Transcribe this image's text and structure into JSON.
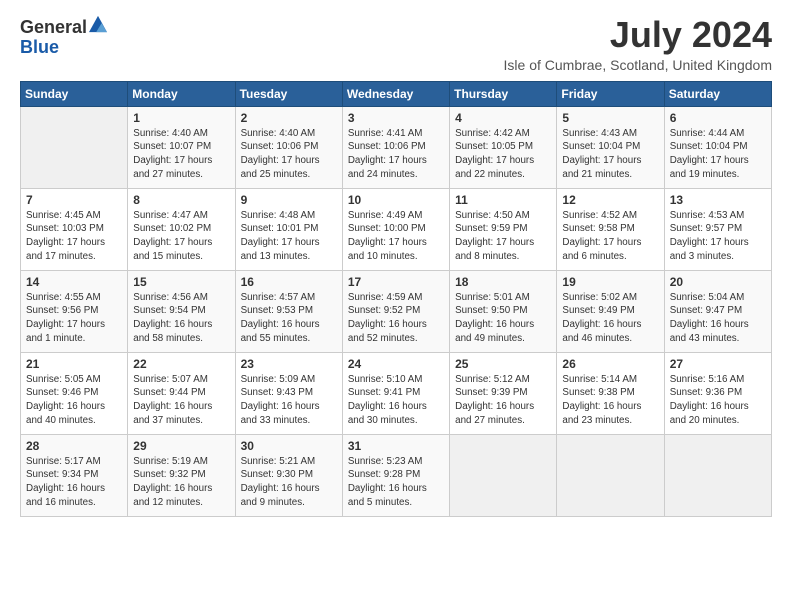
{
  "header": {
    "logo_general": "General",
    "logo_blue": "Blue",
    "month_title": "July 2024",
    "subtitle": "Isle of Cumbrae, Scotland, United Kingdom"
  },
  "weekdays": [
    "Sunday",
    "Monday",
    "Tuesday",
    "Wednesday",
    "Thursday",
    "Friday",
    "Saturday"
  ],
  "weeks": [
    [
      {
        "day": "",
        "info": ""
      },
      {
        "day": "1",
        "info": "Sunrise: 4:40 AM\nSunset: 10:07 PM\nDaylight: 17 hours\nand 27 minutes."
      },
      {
        "day": "2",
        "info": "Sunrise: 4:40 AM\nSunset: 10:06 PM\nDaylight: 17 hours\nand 25 minutes."
      },
      {
        "day": "3",
        "info": "Sunrise: 4:41 AM\nSunset: 10:06 PM\nDaylight: 17 hours\nand 24 minutes."
      },
      {
        "day": "4",
        "info": "Sunrise: 4:42 AM\nSunset: 10:05 PM\nDaylight: 17 hours\nand 22 minutes."
      },
      {
        "day": "5",
        "info": "Sunrise: 4:43 AM\nSunset: 10:04 PM\nDaylight: 17 hours\nand 21 minutes."
      },
      {
        "day": "6",
        "info": "Sunrise: 4:44 AM\nSunset: 10:04 PM\nDaylight: 17 hours\nand 19 minutes."
      }
    ],
    [
      {
        "day": "7",
        "info": "Sunrise: 4:45 AM\nSunset: 10:03 PM\nDaylight: 17 hours\nand 17 minutes."
      },
      {
        "day": "8",
        "info": "Sunrise: 4:47 AM\nSunset: 10:02 PM\nDaylight: 17 hours\nand 15 minutes."
      },
      {
        "day": "9",
        "info": "Sunrise: 4:48 AM\nSunset: 10:01 PM\nDaylight: 17 hours\nand 13 minutes."
      },
      {
        "day": "10",
        "info": "Sunrise: 4:49 AM\nSunset: 10:00 PM\nDaylight: 17 hours\nand 10 minutes."
      },
      {
        "day": "11",
        "info": "Sunrise: 4:50 AM\nSunset: 9:59 PM\nDaylight: 17 hours\nand 8 minutes."
      },
      {
        "day": "12",
        "info": "Sunrise: 4:52 AM\nSunset: 9:58 PM\nDaylight: 17 hours\nand 6 minutes."
      },
      {
        "day": "13",
        "info": "Sunrise: 4:53 AM\nSunset: 9:57 PM\nDaylight: 17 hours\nand 3 minutes."
      }
    ],
    [
      {
        "day": "14",
        "info": "Sunrise: 4:55 AM\nSunset: 9:56 PM\nDaylight: 17 hours\nand 1 minute."
      },
      {
        "day": "15",
        "info": "Sunrise: 4:56 AM\nSunset: 9:54 PM\nDaylight: 16 hours\nand 58 minutes."
      },
      {
        "day": "16",
        "info": "Sunrise: 4:57 AM\nSunset: 9:53 PM\nDaylight: 16 hours\nand 55 minutes."
      },
      {
        "day": "17",
        "info": "Sunrise: 4:59 AM\nSunset: 9:52 PM\nDaylight: 16 hours\nand 52 minutes."
      },
      {
        "day": "18",
        "info": "Sunrise: 5:01 AM\nSunset: 9:50 PM\nDaylight: 16 hours\nand 49 minutes."
      },
      {
        "day": "19",
        "info": "Sunrise: 5:02 AM\nSunset: 9:49 PM\nDaylight: 16 hours\nand 46 minutes."
      },
      {
        "day": "20",
        "info": "Sunrise: 5:04 AM\nSunset: 9:47 PM\nDaylight: 16 hours\nand 43 minutes."
      }
    ],
    [
      {
        "day": "21",
        "info": "Sunrise: 5:05 AM\nSunset: 9:46 PM\nDaylight: 16 hours\nand 40 minutes."
      },
      {
        "day": "22",
        "info": "Sunrise: 5:07 AM\nSunset: 9:44 PM\nDaylight: 16 hours\nand 37 minutes."
      },
      {
        "day": "23",
        "info": "Sunrise: 5:09 AM\nSunset: 9:43 PM\nDaylight: 16 hours\nand 33 minutes."
      },
      {
        "day": "24",
        "info": "Sunrise: 5:10 AM\nSunset: 9:41 PM\nDaylight: 16 hours\nand 30 minutes."
      },
      {
        "day": "25",
        "info": "Sunrise: 5:12 AM\nSunset: 9:39 PM\nDaylight: 16 hours\nand 27 minutes."
      },
      {
        "day": "26",
        "info": "Sunrise: 5:14 AM\nSunset: 9:38 PM\nDaylight: 16 hours\nand 23 minutes."
      },
      {
        "day": "27",
        "info": "Sunrise: 5:16 AM\nSunset: 9:36 PM\nDaylight: 16 hours\nand 20 minutes."
      }
    ],
    [
      {
        "day": "28",
        "info": "Sunrise: 5:17 AM\nSunset: 9:34 PM\nDaylight: 16 hours\nand 16 minutes."
      },
      {
        "day": "29",
        "info": "Sunrise: 5:19 AM\nSunset: 9:32 PM\nDaylight: 16 hours\nand 12 minutes."
      },
      {
        "day": "30",
        "info": "Sunrise: 5:21 AM\nSunset: 9:30 PM\nDaylight: 16 hours\nand 9 minutes."
      },
      {
        "day": "31",
        "info": "Sunrise: 5:23 AM\nSunset: 9:28 PM\nDaylight: 16 hours\nand 5 minutes."
      },
      {
        "day": "",
        "info": ""
      },
      {
        "day": "",
        "info": ""
      },
      {
        "day": "",
        "info": ""
      }
    ]
  ]
}
